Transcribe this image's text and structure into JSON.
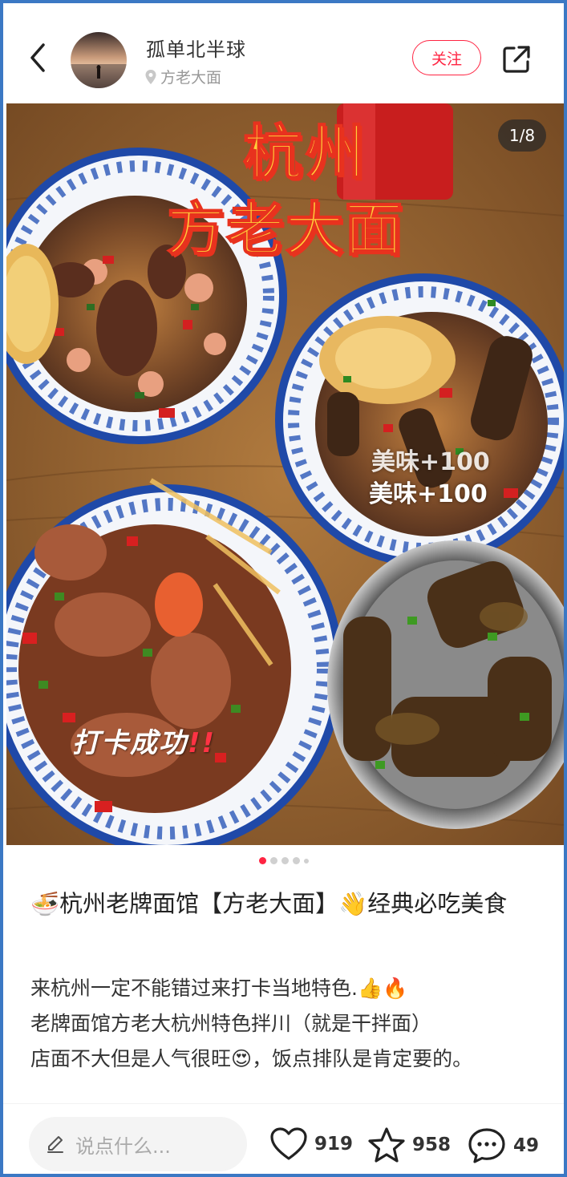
{
  "header": {
    "back_icon": "chevron-left-icon",
    "username": "孤单北半球",
    "location": "方老大面",
    "follow_label": "关注",
    "share_icon": "share-icon"
  },
  "photo": {
    "counter": "1/8",
    "overlay_title_line1": "杭州",
    "overlay_title_line2": "方老大面",
    "overlay_tag1": "美味+100",
    "overlay_tag2": "美味+100",
    "overlay_checkin": "打卡成功",
    "overlay_checkin_mark": "!!"
  },
  "carousel": {
    "total_visible_dots": 5,
    "active_index": 0
  },
  "post": {
    "title": "🍜杭州老牌面馆【方老大面】👋经典必吃美食",
    "body_lines": [
      "来杭州一定不能错过来打卡当地特色.👍🔥",
      "老牌面馆方老大杭州特色拌川（就是干拌面）",
      "店面不大但是人气很旺😍，饭点排队是肯定要的。"
    ]
  },
  "bottom_bar": {
    "comment_placeholder": "说点什么...",
    "like_count": "919",
    "star_count": "958",
    "comment_count": "49"
  },
  "colors": {
    "accent": "#ff2442",
    "frame": "#3b78c4"
  }
}
